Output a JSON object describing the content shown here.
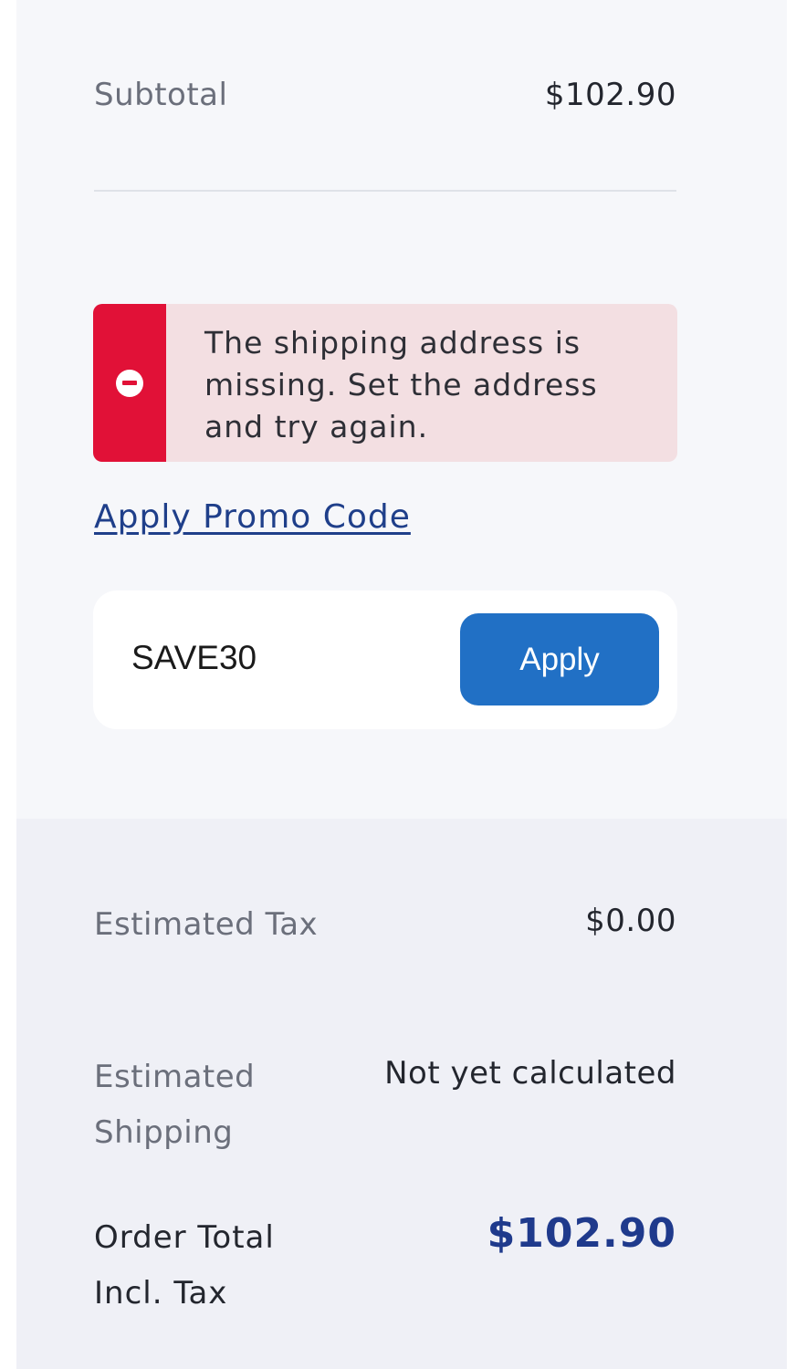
{
  "summary": {
    "subtotal_label": "Subtotal",
    "subtotal_value": "$102.90"
  },
  "alert": {
    "message": "The shipping address is missing. Set the address and try again.",
    "icon": "minus-circle-icon",
    "color": "#e11137"
  },
  "promo": {
    "link_label": "Apply Promo Code",
    "code_value": "SAVE30",
    "apply_label": "Apply",
    "button_color": "#2170c5"
  },
  "totals": {
    "tax_label": "Estimated Tax",
    "tax_value": "$0.00",
    "shipping_label": "Estimated Shipping",
    "shipping_value": "Not yet calculated",
    "order_total_label": "Order Total Incl. Tax",
    "order_total_value": "$102.90",
    "total_color": "#1f3a8c"
  }
}
